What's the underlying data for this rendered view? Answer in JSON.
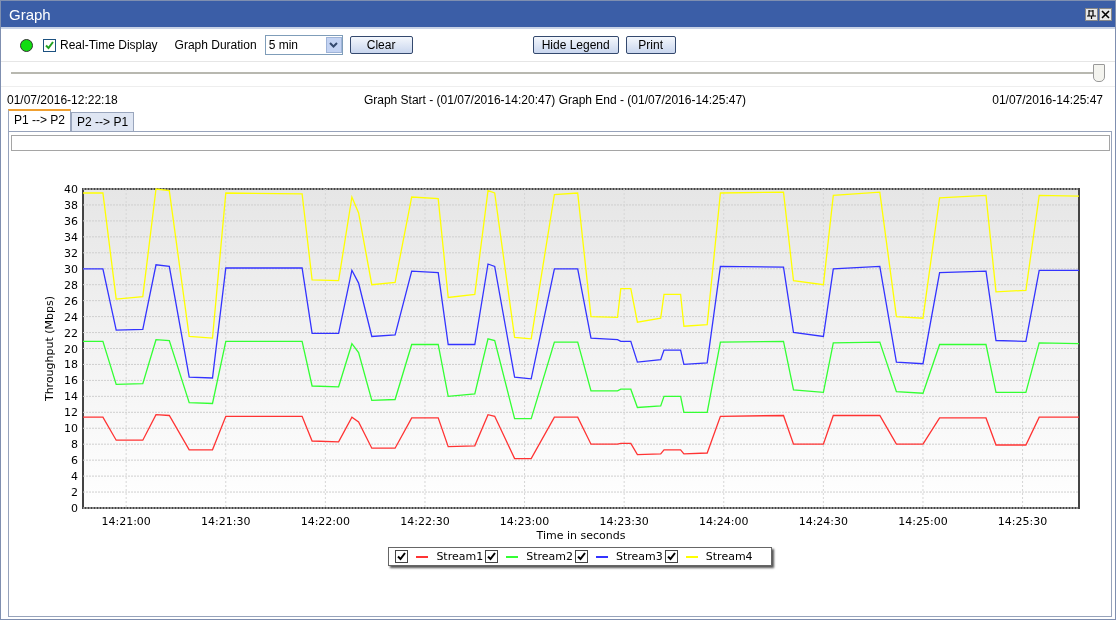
{
  "window": {
    "title": "Graph"
  },
  "toolbar": {
    "live_indicator": {
      "on": true
    },
    "realtime": {
      "label": "Real-Time Display",
      "checked": true
    },
    "duration": {
      "label": "Graph Duration",
      "value": "5 min"
    },
    "buttons": [
      {
        "label": "Clear"
      },
      {
        "label": "Hide Legend"
      },
      {
        "label": "Print"
      }
    ]
  },
  "timeline": {
    "level": 1,
    "start": "01/07/2016-12:22:18",
    "range": "Graph Start - (01/07/2016-14:20:47) Graph End - (01/07/2016-14:25:47)",
    "end": "01/07/2016-14:25:47"
  },
  "tabs": [
    {
      "label": "P1 --> P2",
      "selected": true
    },
    {
      "label": "P2 --> P1",
      "selected": false
    }
  ],
  "chart_data": {
    "type": "line",
    "xlabel": "Time in seconds",
    "ylabel": "Throughput (Mbps)",
    "x": [
      51647,
      51653,
      51657,
      51665,
      51669,
      51673,
      51679,
      51686,
      51690,
      51713,
      51716,
      51724,
      51728,
      51730,
      51734,
      51741,
      51746,
      51754,
      51757,
      51765,
      51769,
      51771,
      51777,
      51782,
      51789,
      51796,
      51800,
      51808,
      51809,
      51812,
      51814,
      51821,
      51822,
      51827,
      51828,
      51835,
      51839,
      51858,
      51861,
      51870,
      51873,
      51887,
      51892,
      51900,
      51905,
      51919,
      51922,
      51931,
      51935,
      51947
    ],
    "series": [
      {
        "name": "Stream1",
        "color": "#ff3333",
        "values": [
          11.4,
          11.4,
          8.5,
          8.5,
          11.7,
          11.6,
          7.3,
          7.3,
          11.5,
          11.5,
          8.4,
          8.3,
          11.4,
          10.8,
          7.5,
          7.5,
          11.3,
          11.3,
          7.7,
          7.8,
          11.7,
          11.5,
          6.2,
          6.2,
          11.4,
          11.4,
          8,
          8,
          8.1,
          8.1,
          6.7,
          6.8,
          7.3,
          7.3,
          6.8,
          6.9,
          11.5,
          11.6,
          8,
          8,
          11.6,
          11.6,
          8,
          8,
          11.3,
          11.3,
          7.9,
          7.9,
          11.4,
          11.4
        ]
      },
      {
        "name": "Stream2",
        "color": "#33ff33",
        "values": [
          20.9,
          20.9,
          15.5,
          15.6,
          21.1,
          21,
          13.2,
          13.1,
          20.9,
          20.9,
          15.3,
          15.2,
          20.6,
          19.5,
          13.5,
          13.6,
          20.5,
          20.5,
          14,
          14.3,
          21.2,
          21,
          11.2,
          11.2,
          20.8,
          20.8,
          14.7,
          14.7,
          14.9,
          14.9,
          12.6,
          12.8,
          14,
          14,
          12,
          12,
          20.8,
          20.9,
          14.8,
          14.5,
          20.7,
          20.8,
          14.6,
          14.4,
          20.5,
          20.5,
          14.5,
          14.5,
          20.7,
          20.6
        ]
      },
      {
        "name": "Stream3",
        "color": "#3333ff",
        "values": [
          30,
          30,
          22.3,
          22.4,
          30.5,
          30.3,
          16.4,
          16.3,
          30.1,
          30.1,
          21.9,
          21.9,
          29.8,
          28.2,
          21.5,
          21.7,
          29.7,
          29.5,
          20.5,
          20.5,
          30.6,
          30.3,
          16.4,
          16.2,
          30,
          30,
          21.3,
          21.1,
          20.9,
          20.9,
          18.3,
          18.6,
          19.8,
          19.8,
          18,
          18.2,
          30.3,
          30.2,
          22,
          21.5,
          30,
          30.3,
          18.3,
          18.1,
          29.5,
          29.7,
          21,
          20.9,
          29.8,
          29.8
        ]
      },
      {
        "name": "Stream4",
        "color": "#ffff00",
        "values": [
          39.5,
          39.5,
          26.2,
          26.5,
          40,
          39.8,
          21.5,
          21.3,
          39.5,
          39.4,
          28.6,
          28.5,
          39,
          37,
          28,
          28.3,
          39,
          38.8,
          26.4,
          26.8,
          39.8,
          39.5,
          21.4,
          21.2,
          39.3,
          39.5,
          24,
          23.9,
          27.5,
          27.5,
          23.3,
          23.8,
          26.8,
          26.8,
          22.8,
          23,
          39.5,
          39.6,
          28.5,
          28,
          39.2,
          39.6,
          24,
          23.8,
          38.9,
          39.2,
          27.1,
          27.3,
          39.2,
          39.1
        ]
      }
    ],
    "xlim": [
      51647,
      51947
    ],
    "ylim": [
      0,
      40
    ],
    "xticks": [
      {
        "value": 51660,
        "label": "14:21:00"
      },
      {
        "value": 51690,
        "label": "14:21:30"
      },
      {
        "value": 51720,
        "label": "14:22:00"
      },
      {
        "value": 51750,
        "label": "14:22:30"
      },
      {
        "value": 51780,
        "label": "14:23:00"
      },
      {
        "value": 51810,
        "label": "14:23:30"
      },
      {
        "value": 51840,
        "label": "14:24:00"
      },
      {
        "value": 51870,
        "label": "14:24:30"
      },
      {
        "value": 51900,
        "label": "14:25:00"
      },
      {
        "value": 51930,
        "label": "14:25:30"
      }
    ],
    "yticks": [
      0,
      2,
      4,
      6,
      8,
      10,
      12,
      14,
      16,
      18,
      20,
      22,
      24,
      26,
      28,
      30,
      32,
      34,
      36,
      38,
      40
    ],
    "grid": true,
    "legend": true
  },
  "legend": [
    {
      "checked": true
    },
    {
      "checked": true
    },
    {
      "checked": true
    },
    {
      "checked": true
    }
  ]
}
